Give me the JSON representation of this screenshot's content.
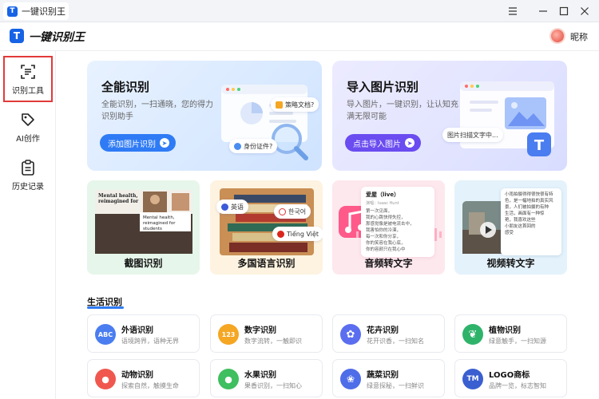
{
  "window": {
    "tab_title": "一键识别王",
    "app_icon_letter": "T",
    "controls": [
      "menu-icon",
      "minimize-icon",
      "maximize-icon",
      "close-icon"
    ]
  },
  "header": {
    "brand": "一键识别王",
    "user_nickname": "昵称"
  },
  "sidebar": {
    "items": [
      {
        "label": "识别工具",
        "icon": "scan-icon",
        "active": true
      },
      {
        "label": "AI创作",
        "icon": "ai-tag-icon",
        "active": false
      },
      {
        "label": "历史记录",
        "icon": "clipboard-icon",
        "active": false
      }
    ]
  },
  "hero": [
    {
      "title": "全能识别",
      "desc": "全能识别，一扫通晓，您的得力识别助手",
      "cta": "添加图片识别",
      "chips": [
        "策略文档?",
        "身份证件?"
      ]
    },
    {
      "title": "导入图片识别",
      "desc": "导入图片，一键识别，让认知充满无限可能",
      "cta": "点击导入图片",
      "chips": [
        "图片扫描文字中..."
      ]
    }
  ],
  "features": [
    {
      "label": "截图识别",
      "preview_text_1": "Mental health, reimagined for",
      "preview_text_2": "Mental health, reimagined for students"
    },
    {
      "label": "多国语言识别",
      "langs": [
        "英语",
        "한국어",
        "Tiếng Việt"
      ]
    },
    {
      "label": "音频转文字",
      "song_title": "爱屋（live）",
      "song_artist": "演唱：Isaac Hunt",
      "lyrics": [
        "第一次见面，",
        "我的心跳快得失控，",
        "那感觉像是被电流击中，",
        "我害怕你的冷漠，",
        "每一次和你分享，",
        "你的笑容在我心底，",
        "你的容颜只在我心中"
      ]
    },
    {
      "label": "视频转文字",
      "transcript": [
        "小雨拍摄得得很快很有特",
        "色，是一幅地拍的真实风",
        "景，人们被拍摄的有种",
        "生活，画面有一种惊",
        "艳，我喜欢这些",
        "小朋友这首回的",
        "感受"
      ]
    }
  ],
  "section": {
    "title": "生活识别",
    "tools": [
      {
        "name": "外语识别",
        "desc": "语境跨界，语种无界",
        "icon_text": "ABC",
        "color": "#4a7df0"
      },
      {
        "name": "数字识别",
        "desc": "数字流转，一触即识",
        "icon_text": "123",
        "color": "#f5a623"
      },
      {
        "name": "花卉识别",
        "desc": "花开识香，一扫知名",
        "icon_text": "✿",
        "color": "#5b6ef0"
      },
      {
        "name": "植物识别",
        "desc": "绿意触手，一扫知源",
        "icon_text": "❦",
        "color": "#2fb36b"
      },
      {
        "name": "动物识别",
        "desc": "探索自然，触摸生命",
        "icon_text": "●",
        "color": "#f0584f"
      },
      {
        "name": "水果识别",
        "desc": "果香识别，一扫知心",
        "icon_text": "●",
        "color": "#3fbf5f"
      },
      {
        "name": "蔬菜识别",
        "desc": "绿意探秘，一扫鲜识",
        "icon_text": "❀",
        "color": "#4e6de8"
      },
      {
        "name": "LOGO商标",
        "desc": "品牌一览，标志智知",
        "icon_text": "TM",
        "color": "#3a5fd0"
      }
    ]
  }
}
